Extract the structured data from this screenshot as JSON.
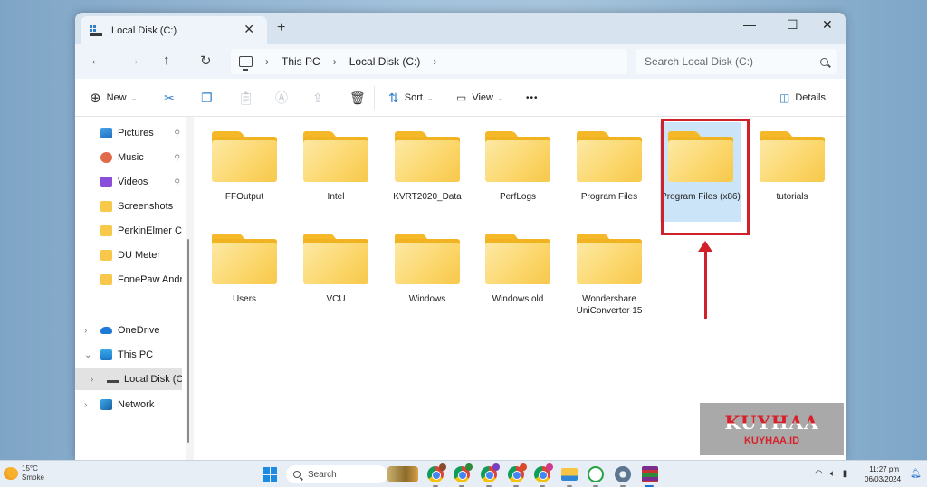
{
  "window": {
    "tab_title": "Local Disk (C:)",
    "tab_close": "✕",
    "new_tab": "+",
    "minimize": "—",
    "maximize": "☐",
    "close": "✕"
  },
  "nav": {
    "back": "←",
    "forward": "→",
    "up": "↑",
    "refresh": "↻",
    "breadcrumbs": [
      "This PC",
      "Local Disk (C:)"
    ],
    "separator": "›",
    "search_placeholder": "Search Local Disk (C:)"
  },
  "toolbar": {
    "new_label": "New",
    "sort_label": "Sort",
    "view_label": "View",
    "more": "•••",
    "details_label": "Details",
    "caret": "⌄"
  },
  "sidebar": {
    "quick_access": [
      {
        "label": "Pictures",
        "icon": "pictures-icon",
        "pinned": true
      },
      {
        "label": "Music",
        "icon": "music-icon",
        "pinned": true
      },
      {
        "label": "Videos",
        "icon": "videos-icon",
        "pinned": true
      },
      {
        "label": "Screenshots",
        "icon": "folder-icon",
        "pinned": false
      },
      {
        "label": "PerkinElmer Che",
        "icon": "folder-icon",
        "pinned": false
      },
      {
        "label": "DU Meter",
        "icon": "folder-icon",
        "pinned": false
      },
      {
        "label": "FonePaw Andro",
        "icon": "folder-icon",
        "pinned": false
      }
    ],
    "tree": [
      {
        "label": "OneDrive",
        "chevron": "›",
        "icon": "onedrive-icon"
      },
      {
        "label": "This PC",
        "chevron": "⌄",
        "icon": "this-pc-icon"
      },
      {
        "label": "Local Disk (C:)",
        "chevron": "›",
        "icon": "drive-icon",
        "selected": true
      },
      {
        "label": "Network",
        "chevron": "›",
        "icon": "network-icon"
      }
    ],
    "pin": "📌"
  },
  "folders": [
    {
      "name": "FFOutput"
    },
    {
      "name": "Intel"
    },
    {
      "name": "KVRT2020_Data"
    },
    {
      "name": "PerfLogs"
    },
    {
      "name": "Program Files"
    },
    {
      "name": "Program Files (x86)",
      "selected": true
    },
    {
      "name": "tutorials"
    },
    {
      "name": "Users"
    },
    {
      "name": "VCU"
    },
    {
      "name": "Windows"
    },
    {
      "name": "Windows.old"
    },
    {
      "name": "Wondershare UniConverter 15"
    }
  ],
  "watermark": {
    "big": "KUYHAA",
    "small": "KUYHAA.ID"
  },
  "taskbar": {
    "weather_temp": "15°C",
    "weather_desc": "Smoke",
    "search_label": "Search",
    "time": "11:27 pm",
    "date": "06/03/2024",
    "chrome_badges": [
      "#8b4a2b",
      "#2e8b3a",
      "#7a3fc0",
      "#d94a2a",
      "#d03a8a"
    ]
  },
  "colors": {
    "annotation_red": "#d0202a",
    "selection_blue": "#cce4f7",
    "folder_yellow": "#f7c84a"
  }
}
